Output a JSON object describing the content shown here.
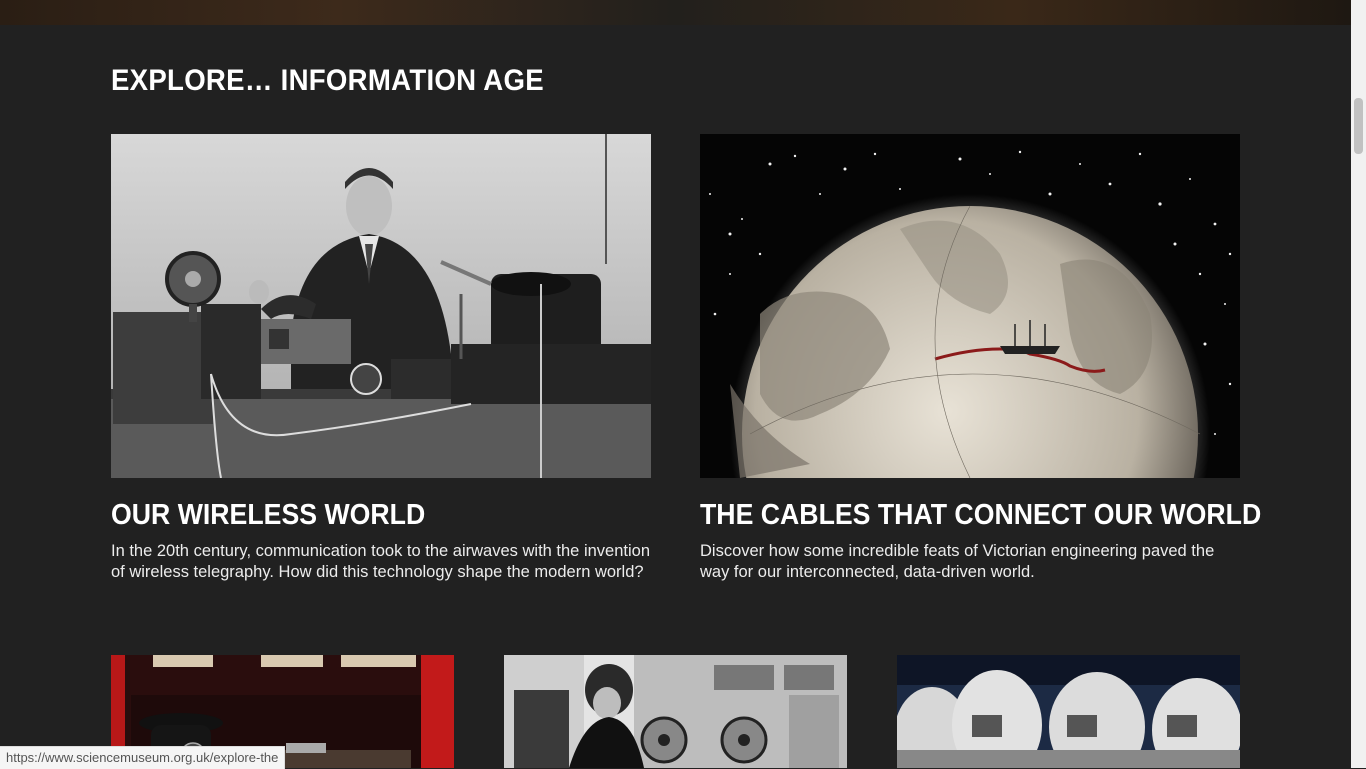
{
  "section": {
    "title": "EXPLORE… INFORMATION AGE"
  },
  "cards": [
    {
      "title": "OUR WIRELESS WORLD",
      "description": "In the 20th century, communication took to the airwaves with the invention of wireless telegraphy. How did this technology shape the modern world?",
      "image": "man-with-wireless-telegraph-apparatus-photo"
    },
    {
      "title": "THE CABLES THAT CONNECT OUR WORLD",
      "description": "Discover how some incredible feats of Victorian engineering paved the way for our interconnected, data-driven world.",
      "image": "globe-with-atlantic-cable-and-ship-photo"
    }
  ],
  "more_cards": [
    {
      "image": "rotary-telephone-in-red-booth-photo"
    },
    {
      "image": "woman-at-tape-computer-photo"
    },
    {
      "image": "satellite-dishes-photo"
    }
  ],
  "status_bar": {
    "url": "https://www.sciencemuseum.org.uk/explore-the"
  }
}
